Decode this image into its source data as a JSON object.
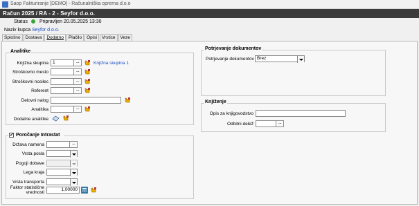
{
  "window": {
    "title": "Saop Fakturiranje [DEMO] - Računalniška oprema d.o.o"
  },
  "header": {
    "document": "Račun  2025 / RA - 2 - Seyfor d.o.o."
  },
  "status": {
    "label": "Status",
    "value": "Pripravljen 20.05.2025 13:30",
    "dot_color": "#3aa33a"
  },
  "kupec": {
    "label": "Naziv kupca",
    "value": "Seyfor d.o.o."
  },
  "tabs": [
    {
      "label": "Splošno"
    },
    {
      "label": "Dostava"
    },
    {
      "label": "Dodatno"
    },
    {
      "label": "Plačilo"
    },
    {
      "label": "Opisi"
    },
    {
      "label": "Vrstice"
    },
    {
      "label": "Veze"
    }
  ],
  "analitike": {
    "title": "Analitike",
    "knjizna_label": "Knjižna skupina",
    "knjizna_value": "1",
    "knjizna_link": "Knjižna skupina 1",
    "stroskovno_mesto_label": "Stroškovno mesto",
    "stroskovni_nosilec_label": "Stroškovni nosilec",
    "referent_label": "Referent",
    "delovni_nalog_label": "Delovni nalog",
    "analitika_label": "Analitika",
    "dodatne_label": "Dodatne analitike"
  },
  "intrastat": {
    "title": "Poročanje Intrastat",
    "checked": true,
    "drzava_label": "Država namena",
    "vrsta_posla_label": "Vrsta posla",
    "pogoji_label": "Pogoji dobave",
    "lega_label": "Lega kraja",
    "transport_label": "Vrsta transporta",
    "faktor_label_1": "Faktor statistične",
    "faktor_label_2": "vrednosti",
    "faktor_value": "1,00000"
  },
  "potrjevanje": {
    "title": "Potrjevanje dokumentov",
    "label": "Potrjevanje dokumentov",
    "value": "Brez"
  },
  "knjizenje": {
    "title": "Knjiženje",
    "opis_label": "Opis za knjigovodstvo",
    "odbitni_label": "Odbitni delež"
  },
  "icons": {
    "hand": "hand-pointer-icon",
    "search": "lookup-icon"
  }
}
